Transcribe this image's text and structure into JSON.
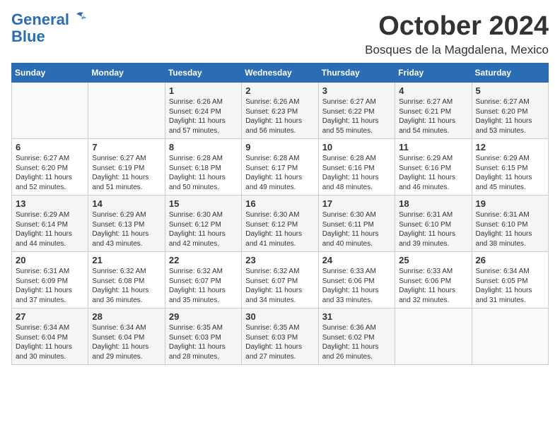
{
  "logo": {
    "line1": "General",
    "line2": "Blue"
  },
  "title": "October 2024",
  "location": "Bosques de la Magdalena, Mexico",
  "weekdays": [
    "Sunday",
    "Monday",
    "Tuesday",
    "Wednesday",
    "Thursday",
    "Friday",
    "Saturday"
  ],
  "weeks": [
    [
      {
        "day": "",
        "info": ""
      },
      {
        "day": "",
        "info": ""
      },
      {
        "day": "1",
        "info": "Sunrise: 6:26 AM\nSunset: 6:24 PM\nDaylight: 11 hours and 57 minutes."
      },
      {
        "day": "2",
        "info": "Sunrise: 6:26 AM\nSunset: 6:23 PM\nDaylight: 11 hours and 56 minutes."
      },
      {
        "day": "3",
        "info": "Sunrise: 6:27 AM\nSunset: 6:22 PM\nDaylight: 11 hours and 55 minutes."
      },
      {
        "day": "4",
        "info": "Sunrise: 6:27 AM\nSunset: 6:21 PM\nDaylight: 11 hours and 54 minutes."
      },
      {
        "day": "5",
        "info": "Sunrise: 6:27 AM\nSunset: 6:20 PM\nDaylight: 11 hours and 53 minutes."
      }
    ],
    [
      {
        "day": "6",
        "info": "Sunrise: 6:27 AM\nSunset: 6:20 PM\nDaylight: 11 hours and 52 minutes."
      },
      {
        "day": "7",
        "info": "Sunrise: 6:27 AM\nSunset: 6:19 PM\nDaylight: 11 hours and 51 minutes."
      },
      {
        "day": "8",
        "info": "Sunrise: 6:28 AM\nSunset: 6:18 PM\nDaylight: 11 hours and 50 minutes."
      },
      {
        "day": "9",
        "info": "Sunrise: 6:28 AM\nSunset: 6:17 PM\nDaylight: 11 hours and 49 minutes."
      },
      {
        "day": "10",
        "info": "Sunrise: 6:28 AM\nSunset: 6:16 PM\nDaylight: 11 hours and 48 minutes."
      },
      {
        "day": "11",
        "info": "Sunrise: 6:29 AM\nSunset: 6:16 PM\nDaylight: 11 hours and 46 minutes."
      },
      {
        "day": "12",
        "info": "Sunrise: 6:29 AM\nSunset: 6:15 PM\nDaylight: 11 hours and 45 minutes."
      }
    ],
    [
      {
        "day": "13",
        "info": "Sunrise: 6:29 AM\nSunset: 6:14 PM\nDaylight: 11 hours and 44 minutes."
      },
      {
        "day": "14",
        "info": "Sunrise: 6:29 AM\nSunset: 6:13 PM\nDaylight: 11 hours and 43 minutes."
      },
      {
        "day": "15",
        "info": "Sunrise: 6:30 AM\nSunset: 6:12 PM\nDaylight: 11 hours and 42 minutes."
      },
      {
        "day": "16",
        "info": "Sunrise: 6:30 AM\nSunset: 6:12 PM\nDaylight: 11 hours and 41 minutes."
      },
      {
        "day": "17",
        "info": "Sunrise: 6:30 AM\nSunset: 6:11 PM\nDaylight: 11 hours and 40 minutes."
      },
      {
        "day": "18",
        "info": "Sunrise: 6:31 AM\nSunset: 6:10 PM\nDaylight: 11 hours and 39 minutes."
      },
      {
        "day": "19",
        "info": "Sunrise: 6:31 AM\nSunset: 6:10 PM\nDaylight: 11 hours and 38 minutes."
      }
    ],
    [
      {
        "day": "20",
        "info": "Sunrise: 6:31 AM\nSunset: 6:09 PM\nDaylight: 11 hours and 37 minutes."
      },
      {
        "day": "21",
        "info": "Sunrise: 6:32 AM\nSunset: 6:08 PM\nDaylight: 11 hours and 36 minutes."
      },
      {
        "day": "22",
        "info": "Sunrise: 6:32 AM\nSunset: 6:07 PM\nDaylight: 11 hours and 35 minutes."
      },
      {
        "day": "23",
        "info": "Sunrise: 6:32 AM\nSunset: 6:07 PM\nDaylight: 11 hours and 34 minutes."
      },
      {
        "day": "24",
        "info": "Sunrise: 6:33 AM\nSunset: 6:06 PM\nDaylight: 11 hours and 33 minutes."
      },
      {
        "day": "25",
        "info": "Sunrise: 6:33 AM\nSunset: 6:06 PM\nDaylight: 11 hours and 32 minutes."
      },
      {
        "day": "26",
        "info": "Sunrise: 6:34 AM\nSunset: 6:05 PM\nDaylight: 11 hours and 31 minutes."
      }
    ],
    [
      {
        "day": "27",
        "info": "Sunrise: 6:34 AM\nSunset: 6:04 PM\nDaylight: 11 hours and 30 minutes."
      },
      {
        "day": "28",
        "info": "Sunrise: 6:34 AM\nSunset: 6:04 PM\nDaylight: 11 hours and 29 minutes."
      },
      {
        "day": "29",
        "info": "Sunrise: 6:35 AM\nSunset: 6:03 PM\nDaylight: 11 hours and 28 minutes."
      },
      {
        "day": "30",
        "info": "Sunrise: 6:35 AM\nSunset: 6:03 PM\nDaylight: 11 hours and 27 minutes."
      },
      {
        "day": "31",
        "info": "Sunrise: 6:36 AM\nSunset: 6:02 PM\nDaylight: 11 hours and 26 minutes."
      },
      {
        "day": "",
        "info": ""
      },
      {
        "day": "",
        "info": ""
      }
    ]
  ]
}
